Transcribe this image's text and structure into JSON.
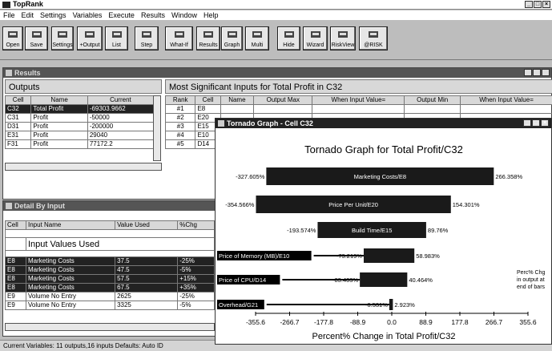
{
  "app": {
    "title": "TopRank"
  },
  "menu": [
    "File",
    "Edit",
    "Settings",
    "Variables",
    "Execute",
    "Results",
    "Window",
    "Help"
  ],
  "toolbar": [
    {
      "label": "Open",
      "icon": "folder-icon"
    },
    {
      "label": "Save",
      "icon": "save-icon"
    },
    {
      "label": "Settings",
      "icon": "settings-icon"
    },
    {
      "label": "+Output",
      "icon": "add-output-icon"
    },
    {
      "label": "List",
      "icon": "list-icon"
    },
    {
      "label": "Step",
      "icon": "step-icon"
    },
    {
      "label": "What-If",
      "icon": "what-if-icon"
    },
    {
      "label": "Results",
      "icon": "results-icon"
    },
    {
      "label": "Graph",
      "icon": "graph-icon"
    },
    {
      "label": "Multi",
      "icon": "multi-icon"
    },
    {
      "label": "Hide",
      "icon": "hide-icon"
    },
    {
      "label": "Wizard",
      "icon": "wizard-icon"
    },
    {
      "label": "RiskView",
      "icon": "riskview-icon"
    },
    {
      "label": "@RISK",
      "icon": "atrisk-icon"
    }
  ],
  "results": {
    "title": "Results",
    "outputs_header": "Outputs",
    "outputs_cols": [
      "Cell",
      "Name",
      "Current"
    ],
    "outputs_rows": [
      {
        "cell": "C32",
        "name": "Total Profit",
        "current": "-69303.9662"
      },
      {
        "cell": "C31",
        "name": "Profit",
        "current": "-50000"
      },
      {
        "cell": "D31",
        "name": "Profit",
        "current": "-200000"
      },
      {
        "cell": "E31",
        "name": "Profit",
        "current": "29040"
      },
      {
        "cell": "F31",
        "name": "Profit",
        "current": "77172.2"
      }
    ],
    "inputs_header": "Most Significant Inputs for Total Profit in C32",
    "inputs_cols": [
      "Rank",
      "Cell",
      "Name",
      "Output Max",
      "When Input Value=",
      "Output Min",
      "When Input Value="
    ],
    "inputs_rows": [
      {
        "rank": "#1",
        "cell": "E8"
      },
      {
        "rank": "#2",
        "cell": "E20"
      },
      {
        "rank": "#3",
        "cell": "E15"
      },
      {
        "rank": "#4",
        "cell": "E10"
      },
      {
        "rank": "#5",
        "cell": "D14"
      }
    ]
  },
  "detail": {
    "title": "Detail By Input",
    "section": "Input Values Used",
    "cols": [
      "Cell",
      "Input Name",
      "Value Used",
      "%Chg"
    ],
    "rows": [
      {
        "cell": "E8",
        "name": "Marketing Costs",
        "value": "37.5",
        "chg": "-25%"
      },
      {
        "cell": "E8",
        "name": "Marketing Costs",
        "value": "47.5",
        "chg": "-5%"
      },
      {
        "cell": "E8",
        "name": "Marketing Costs",
        "value": "57.5",
        "chg": "+15%"
      },
      {
        "cell": "E8",
        "name": "Marketing Costs",
        "value": "67.5",
        "chg": "+35%"
      },
      {
        "cell": "E9",
        "name": "Volume No Entry",
        "value": "2625",
        "chg": "-25%"
      },
      {
        "cell": "E9",
        "name": "Volume No Entry",
        "value": "3325",
        "chg": "-5%"
      }
    ]
  },
  "status": "Current Variables: 11 outputs,16 inputs   Defaults: Auto ID",
  "tornado_window": {
    "title": "Tornado Graph - Cell C32"
  },
  "chart_data": {
    "type": "bar",
    "orientation": "horizontal-tornado",
    "title": "Tornado Graph for Total Profit/C32",
    "xlabel": "Percent% Change in Total Profit/C32",
    "xlim": [
      -355.6,
      355.6
    ],
    "xticks": [
      "-355.6",
      "-266.7",
      "-177.8",
      "-88.9",
      "0.0",
      "88.9",
      "177.8",
      "266.7",
      "355.6"
    ],
    "note": "Perc% Chg in output at end of bars",
    "bars": [
      {
        "label": "Marketing Costs/E8",
        "min": -327.605,
        "max": 266.358,
        "min_label": "-327.605%",
        "max_label": "266.358%"
      },
      {
        "label": "Price Per Unit/E20",
        "min": -354.566,
        "max": 154.301,
        "min_label": "-354.566%",
        "max_label": "154.301%"
      },
      {
        "label": "Build Time/E15",
        "min": -193.574,
        "max": 89.76,
        "min_label": "-193.574%",
        "max_label": "89.76%"
      },
      {
        "label": "Price of Memory (MB)/E10",
        "min": -73.219,
        "max": 58.983,
        "min_label": "-73.219%",
        "max_label": "58.983%"
      },
      {
        "label": "Price of CPU/D14",
        "min": -83.403,
        "max": 40.464,
        "min_label": "-83.403%",
        "max_label": "40.464%"
      },
      {
        "label": "Overhead/G21",
        "min": -6.531,
        "max": 2.923,
        "min_label": "-6.531%",
        "max_label": "2.923%"
      }
    ],
    "colors": {
      "bar": "#1a1a1a",
      "bar_label": "#ffffff"
    }
  }
}
